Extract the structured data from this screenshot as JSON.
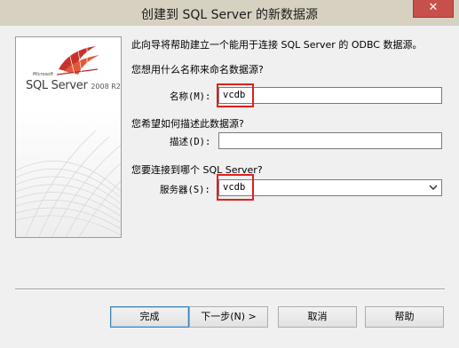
{
  "window": {
    "title": "创建到 SQL Server 的新数据源",
    "close_symbol": "✕"
  },
  "logo": {
    "brand": "Microsoft",
    "product": "SQL Server",
    "version": "2008 R2"
  },
  "intro_text": "此向导将帮助建立一个能用于连接 SQL Server 的 ODBC 数据源。",
  "name_section": {
    "question": "您想用什么名称来命名数据源?",
    "label": "名称(M):",
    "value": "vcdb"
  },
  "description_section": {
    "question": "您希望如何描述此数据源?",
    "label": "描述(D):",
    "value": ""
  },
  "server_section": {
    "question": "您要连接到哪个 SQL Server?",
    "label": "服务器(S):",
    "value": "vcdb"
  },
  "buttons": {
    "finish": "完成",
    "next": "下一步(N) >",
    "cancel": "取消",
    "help": "帮助"
  },
  "colors": {
    "titlebar": "#d7d1c1",
    "close_button": "#c7504a",
    "highlight": "#e02020",
    "default_button_border": "#3c7fb1"
  }
}
